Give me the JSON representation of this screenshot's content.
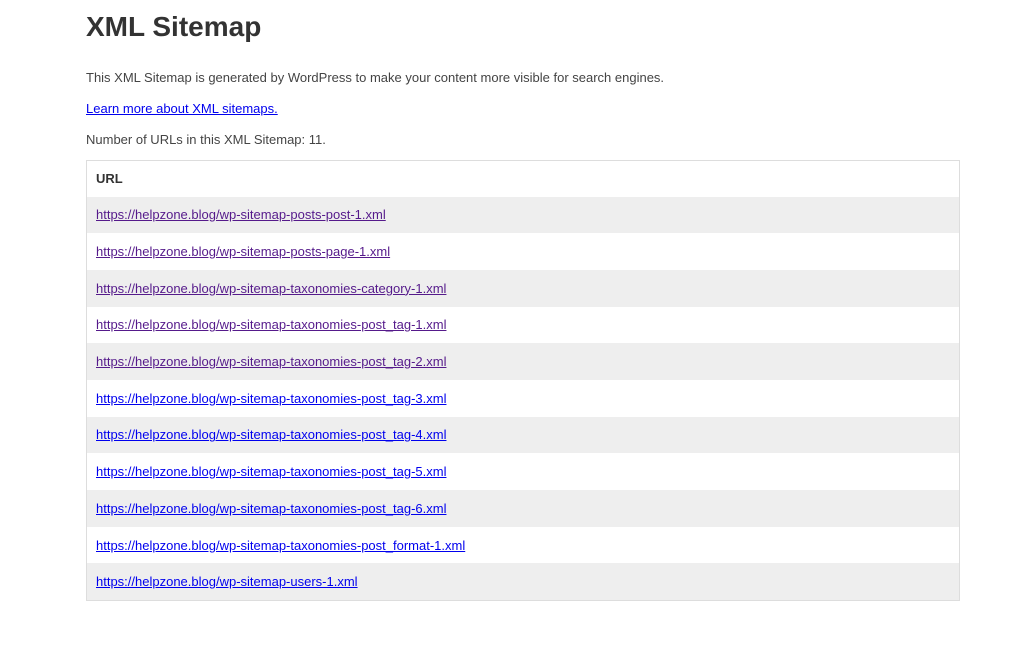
{
  "page": {
    "title": "XML Sitemap",
    "description": "This XML Sitemap is generated by WordPress to make your content more visible for search engines.",
    "learn_more_link": "Learn more about XML sitemaps.",
    "url_count_text": "Number of URLs in this XML Sitemap: 11."
  },
  "table": {
    "header": "URL",
    "rows": [
      {
        "url": "https://helpzone.blog/wp-sitemap-posts-post-1.xml",
        "visited": true
      },
      {
        "url": "https://helpzone.blog/wp-sitemap-posts-page-1.xml",
        "visited": true
      },
      {
        "url": "https://helpzone.blog/wp-sitemap-taxonomies-category-1.xml",
        "visited": true
      },
      {
        "url": "https://helpzone.blog/wp-sitemap-taxonomies-post_tag-1.xml",
        "visited": true
      },
      {
        "url": "https://helpzone.blog/wp-sitemap-taxonomies-post_tag-2.xml",
        "visited": true
      },
      {
        "url": "https://helpzone.blog/wp-sitemap-taxonomies-post_tag-3.xml",
        "visited": false
      },
      {
        "url": "https://helpzone.blog/wp-sitemap-taxonomies-post_tag-4.xml",
        "visited": false
      },
      {
        "url": "https://helpzone.blog/wp-sitemap-taxonomies-post_tag-5.xml",
        "visited": false
      },
      {
        "url": "https://helpzone.blog/wp-sitemap-taxonomies-post_tag-6.xml",
        "visited": false
      },
      {
        "url": "https://helpzone.blog/wp-sitemap-taxonomies-post_format-1.xml",
        "visited": false
      },
      {
        "url": "https://helpzone.blog/wp-sitemap-users-1.xml",
        "visited": false
      }
    ]
  },
  "colors": {
    "link": "#0000ee",
    "visited_link": "#551a8b",
    "row_stripe": "#eeeeee",
    "text": "#444444"
  }
}
